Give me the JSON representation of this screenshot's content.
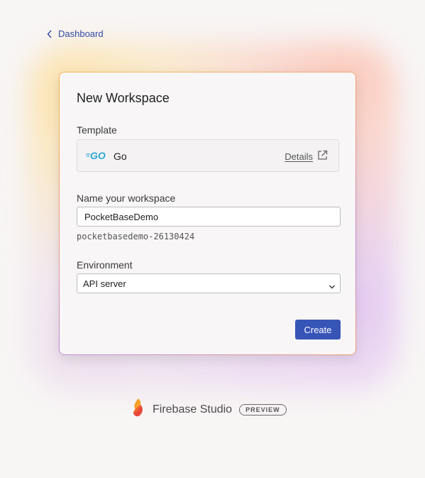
{
  "nav": {
    "back_label": "Dashboard"
  },
  "card": {
    "title": "New Workspace",
    "template": {
      "label": "Template",
      "name": "Go",
      "logo_text": "GO",
      "details_label": "Details"
    },
    "name_field": {
      "label": "Name your workspace",
      "value": "PocketBaseDemo",
      "slug": "pocketbasedemo-26130424"
    },
    "environment": {
      "label": "Environment",
      "selected": "API server"
    },
    "create_label": "Create"
  },
  "footer": {
    "brand": "Firebase Studio",
    "badge": "PREVIEW"
  },
  "colors": {
    "accent": "#3754b7",
    "link": "#2f49a8",
    "go_blue": "#29a9d6"
  }
}
